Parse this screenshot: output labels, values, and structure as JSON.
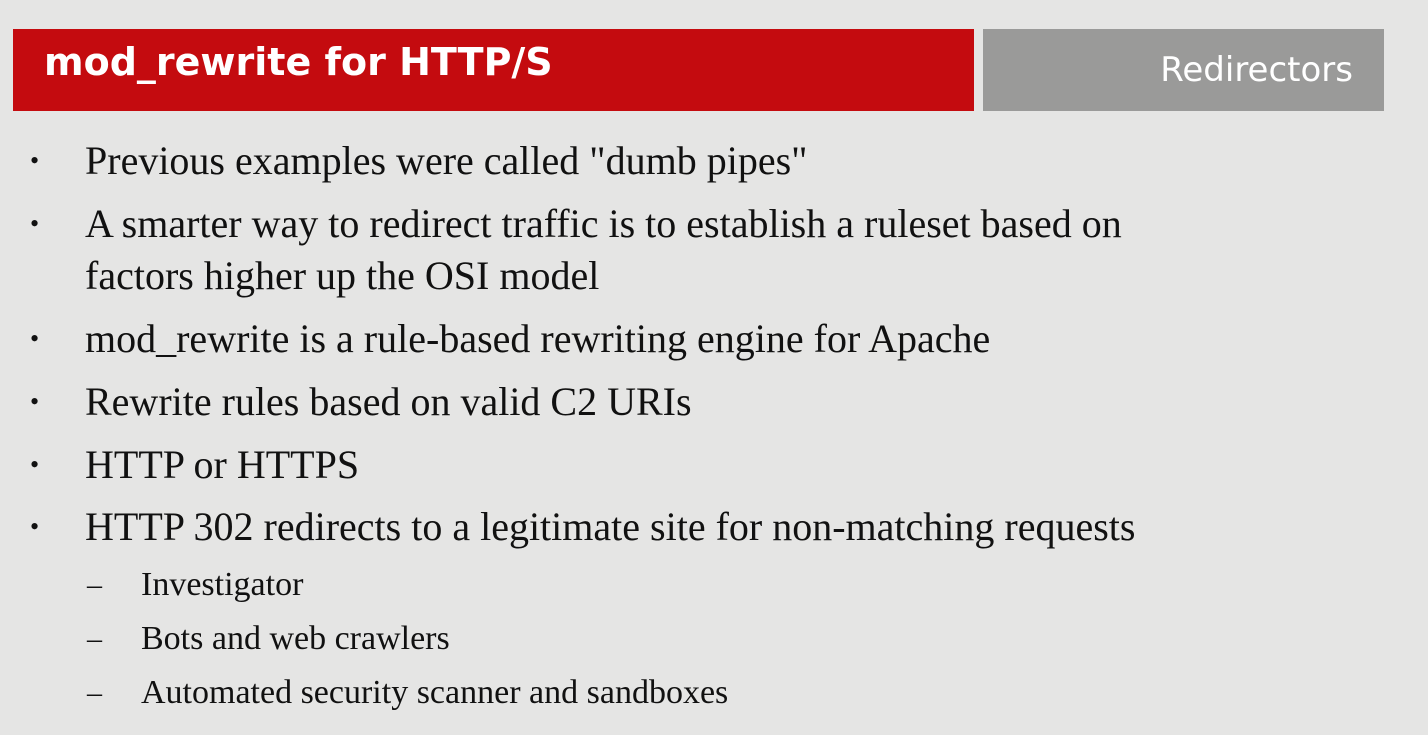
{
  "header": {
    "title": "mod_rewrite for HTTP/S",
    "section": "Redirectors",
    "title_color": "#c40b0f",
    "section_color": "#9a9a99"
  },
  "bullet_marker": "•",
  "sub_marker": "–",
  "bullets": [
    {
      "lines": [
        "Previous examples were called \"dumb pipes\""
      ]
    },
    {
      "lines": [
        "A smarter way to redirect traffic is to establish a ruleset based on",
        "factors higher up the OSI model"
      ]
    },
    {
      "lines": [
        "mod_rewrite is a rule-based rewriting engine for Apache"
      ]
    },
    {
      "lines": [
        "Rewrite rules based on valid C2 URIs"
      ]
    },
    {
      "lines": [
        "HTTP or HTTPS"
      ]
    },
    {
      "lines": [
        "HTTP 302 redirects to a legitimate site for non-matching requests"
      ]
    }
  ],
  "sub_bullets": [
    "Investigator",
    "Bots and web crawlers",
    "Automated security scanner and sandboxes"
  ]
}
